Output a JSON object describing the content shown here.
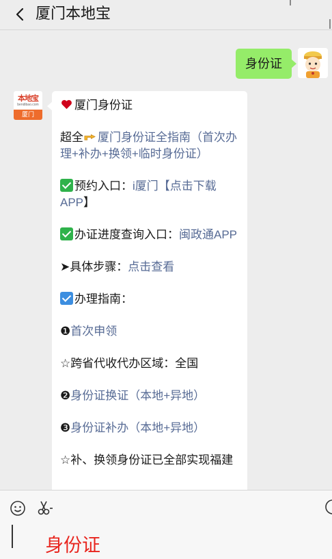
{
  "header": {
    "title": "厦门本地宝"
  },
  "chat": {
    "self_message": "身份证",
    "bot_avatar": {
      "logo_text": "本地宝",
      "logo_sub": "bendibao.com",
      "band_text": "厦门"
    },
    "bot_message": {
      "heading": "厦门身份证",
      "guide_prefix": "超全",
      "guide_link": "厦门身份证全指南（首次办理+补办+换领+临时身份证）",
      "booking_prefix": "预约入口：",
      "booking_link": "i厦门【点击下载APP",
      "booking_suffix": "】",
      "progress_prefix": "办证进度查询入口：",
      "progress_link": "闽政通APP",
      "steps_prefix": "➤具体步骤：",
      "steps_link": "点击查看",
      "guide2_label": "办理指南：",
      "item1_num": "❶",
      "item1_link": "首次申领",
      "cross_region": "☆跨省代收代办区域：全国",
      "item2_num": "❷",
      "item2_link": "身份证换证（本地+异地）",
      "item3_num": "❸",
      "item3_link": "身份证补办（本地+异地）",
      "note": "☆补、换领身份证已全部实现福建"
    }
  },
  "input": {
    "value": "身份证"
  },
  "colors": {
    "self_bubble": "#95ec69",
    "link": "#576b95",
    "input_text": "#e8251e"
  }
}
